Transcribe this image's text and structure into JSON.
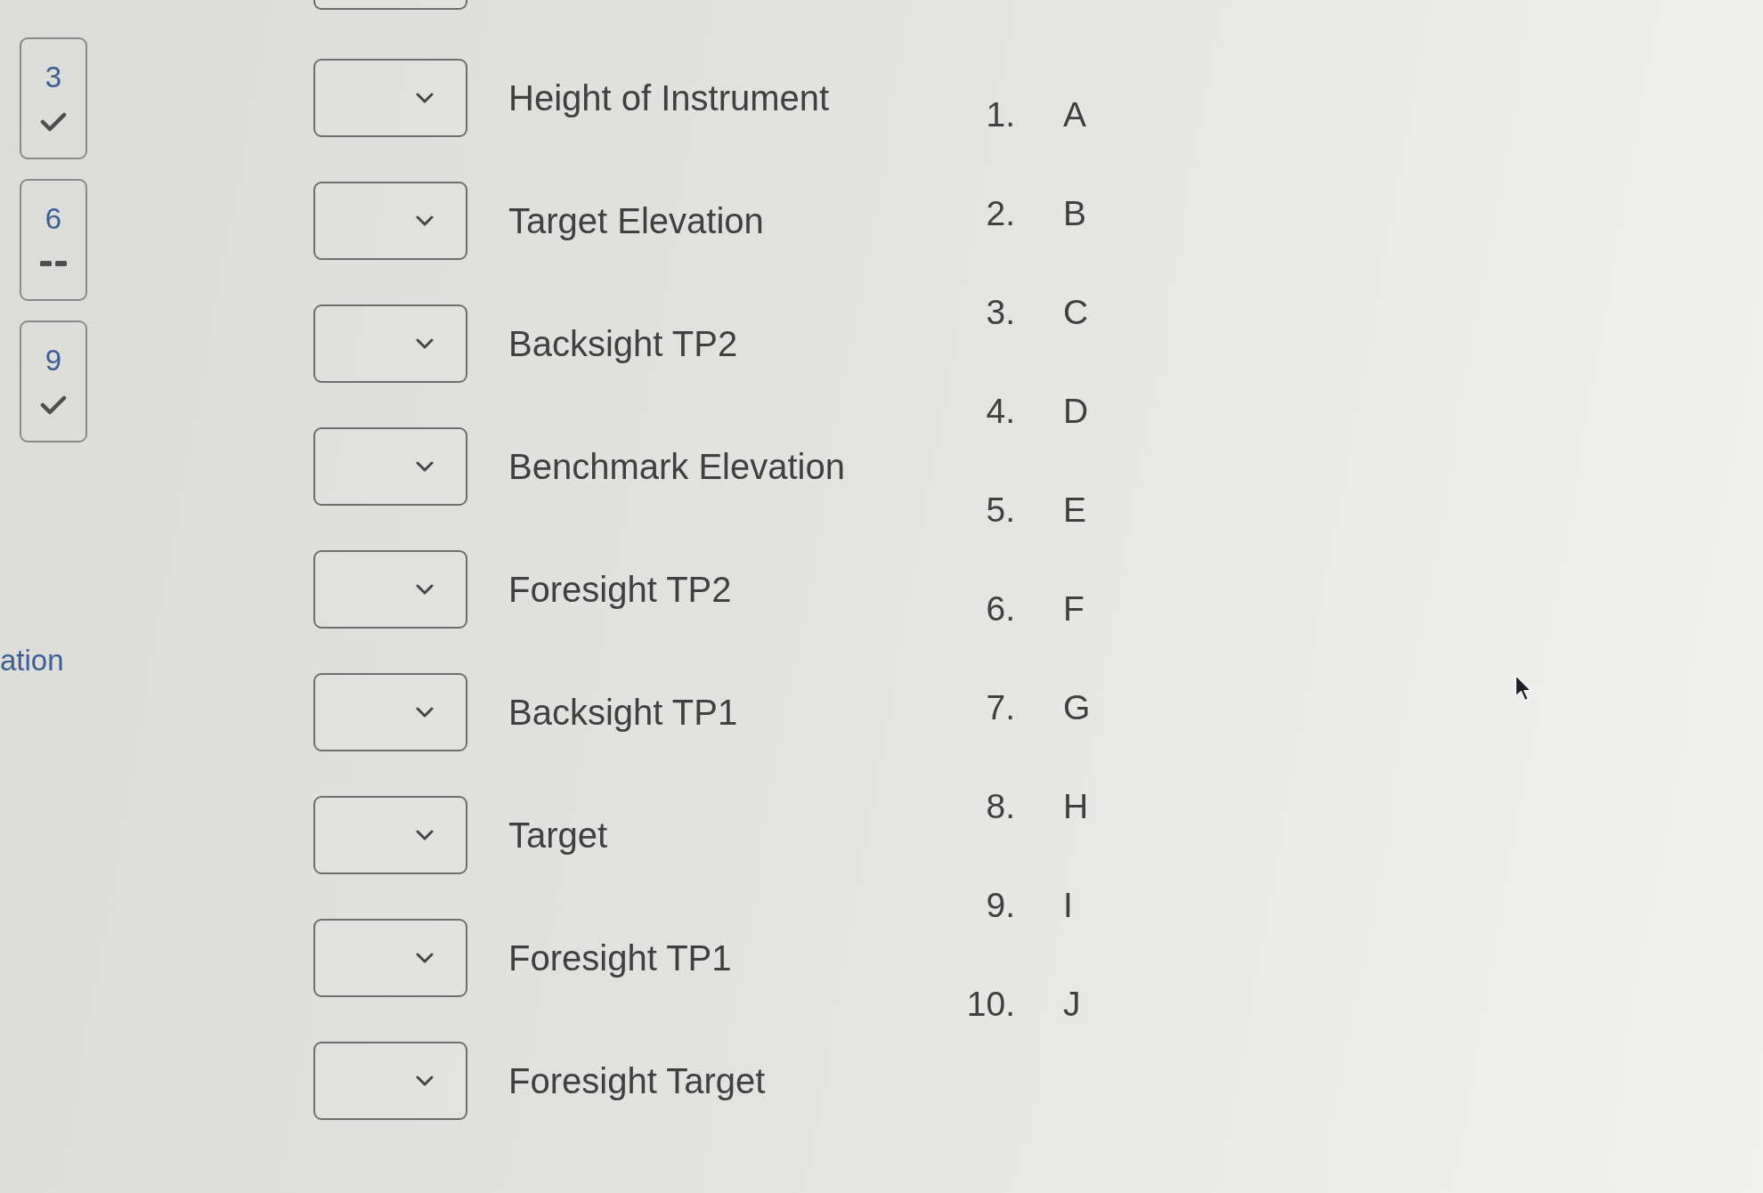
{
  "question_nav": [
    {
      "number": "3",
      "answered": true
    },
    {
      "number": "6",
      "answered": false
    },
    {
      "number": "9",
      "answered": true
    }
  ],
  "sidebar_fragment": "ation",
  "matching": {
    "rows": [
      {
        "cut_off": true
      },
      {
        "cut_off": false,
        "prompt": "Height of Instrument"
      },
      {
        "cut_off": false,
        "prompt": "Target Elevation"
      },
      {
        "cut_off": false,
        "prompt": "Backsight TP2"
      },
      {
        "cut_off": false,
        "prompt": "Benchmark Elevation"
      },
      {
        "cut_off": false,
        "prompt": "Foresight TP2"
      },
      {
        "cut_off": false,
        "prompt": "Backsight TP1"
      },
      {
        "cut_off": false,
        "prompt": "Target"
      },
      {
        "cut_off": false,
        "prompt": "Foresight TP1"
      },
      {
        "cut_off": false,
        "prompt": "Foresight Target"
      }
    ]
  },
  "choices": [
    {
      "number": "1.",
      "letter": "A"
    },
    {
      "number": "2.",
      "letter": "B"
    },
    {
      "number": "3.",
      "letter": "C"
    },
    {
      "number": "4.",
      "letter": "D"
    },
    {
      "number": "5.",
      "letter": "E"
    },
    {
      "number": "6.",
      "letter": "F"
    },
    {
      "number": "7.",
      "letter": "G"
    },
    {
      "number": "8.",
      "letter": "H"
    },
    {
      "number": "9.",
      "letter": "I"
    },
    {
      "number": "10.",
      "letter": "J"
    }
  ]
}
